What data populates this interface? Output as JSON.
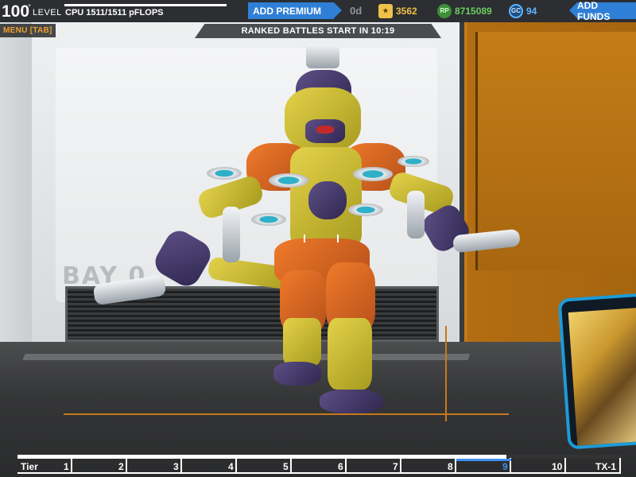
{
  "hud": {
    "level": "100",
    "level_suffix": "+",
    "level_label": "LEVEL",
    "cpu_text": "CPU 1511/1511 pFLOPS",
    "cpu_fill": 1.0,
    "premium_button": "ADD PREMIUM",
    "premium_days": "0d",
    "tech_points": "3562",
    "rp": "8715089",
    "gc": "94",
    "funds_button": "ADD FUNDS",
    "menu_tag": "MENU [TAB]",
    "ranked_banner": "RANKED BATTLES START IN 10:19"
  },
  "icons": {
    "tech": "tech-point-icon",
    "rp": "robit-points-icon",
    "gc": "galaxy-coins-icon"
  },
  "scene": {
    "bay_label": "BAY 0"
  },
  "tiers": {
    "label": "Tier",
    "items": [
      "1",
      "2",
      "3",
      "4",
      "5",
      "6",
      "7",
      "8",
      "9",
      "10",
      "TX-1"
    ],
    "active": "9"
  },
  "colors": {
    "accent": "#2f7fd6",
    "tier_active": "#3f8ff0",
    "menu_tag": "#f0a030"
  }
}
